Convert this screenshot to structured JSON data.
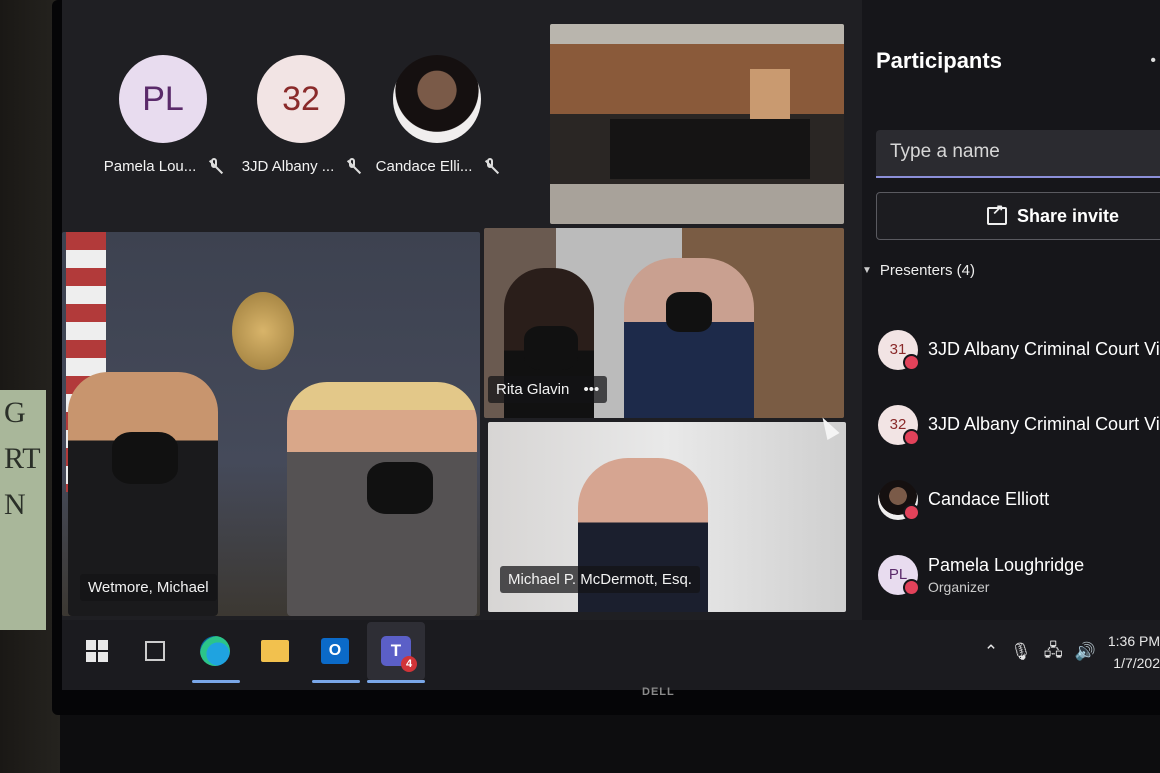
{
  "poster_letters": [
    "G",
    "RT",
    "N"
  ],
  "stage": {
    "avatars": [
      {
        "initials": "PL",
        "name": "Pamela Lou...",
        "muted": true
      },
      {
        "initials": "32",
        "name": "3JD Albany ...",
        "muted": true
      },
      {
        "initials": "",
        "name": "Candace Elli...",
        "muted": true
      }
    ],
    "tiles": {
      "office_name": "Wetmore, Michael",
      "rita_name": "Rita Glavin",
      "rita_more": "•••",
      "mcd_name": "Michael P. McDermott, Esq."
    }
  },
  "panel": {
    "title": "Participants",
    "more": "•",
    "search_placeholder": "Type a name",
    "share_label": "Share invite",
    "presenters_label": "Presenters (4)",
    "participants": [
      {
        "initials": "31",
        "name": "3JD Albany Criminal Court Vi...",
        "role": ""
      },
      {
        "initials": "32",
        "name": "3JD Albany Criminal Court Vi...",
        "role": ""
      },
      {
        "initials": "",
        "name": "Candace Elliott",
        "role": ""
      },
      {
        "initials": "PL",
        "name": "Pamela Loughridge",
        "role": "Organizer"
      }
    ]
  },
  "taskbar": {
    "outlook_letter": "O",
    "teams_letter": "T",
    "teams_badge": "4",
    "time": "1:36 PM",
    "date": "1/7/202"
  },
  "monitor_brand": "DELL",
  "colors": {
    "accent": "#8b8fd8",
    "status_red": "#e2425a",
    "teams_purple": "#5b5fc7"
  }
}
